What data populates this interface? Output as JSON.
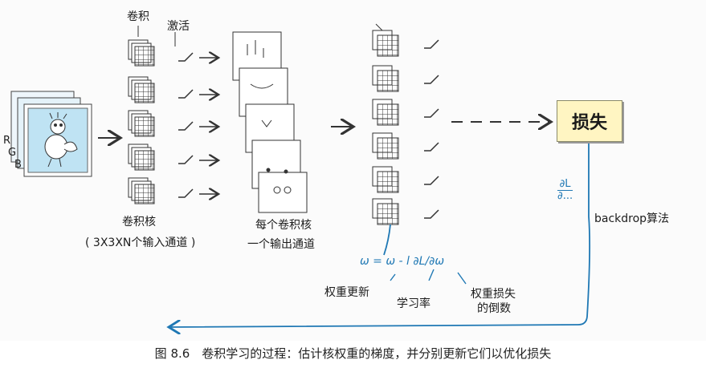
{
  "labels": {
    "conv_top": "卷积",
    "activation": "激活",
    "channels": [
      "R",
      "G",
      "B"
    ],
    "kernels": "卷积核",
    "kernels_sub": "( 3X3XN个输入通道 )",
    "per_kernel": "每个卷积核",
    "per_kernel_sub": "一个输出通道",
    "loss": "损失",
    "backprop": "backdrop算法",
    "dl_num": "∂L",
    "dl_den": "∂...",
    "update_formula": "ω   = ω  - l ∂L/∂ω",
    "weight_update": "权重更新",
    "learning_rate": "学习率",
    "loss_grad_1": "权重损失",
    "loss_grad_2": "的倒数"
  },
  "caption": "图 8.6　卷积学习的过程：估计核权重的梯度，并分别更新它们以优化损失",
  "colors": {
    "accent_blue": "#1f78b4",
    "loss_fill": "#fff5c2",
    "image_blue": "#bfe3f3"
  }
}
